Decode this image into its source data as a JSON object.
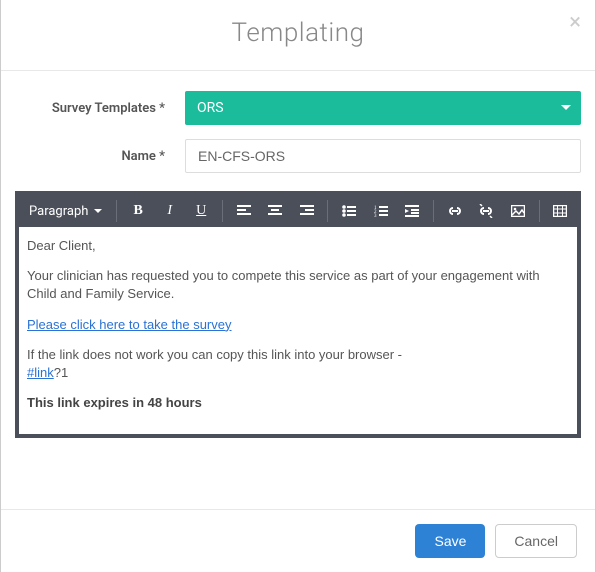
{
  "header": {
    "title": "Templating",
    "close": "×"
  },
  "form": {
    "survey_templates_label": "Survey Templates *",
    "survey_templates_value": "ORS",
    "name_label": "Name *",
    "name_value": "EN-CFS-ORS"
  },
  "editor": {
    "paragraph_label": "Paragraph",
    "content": {
      "greeting": "Dear Client,",
      "body": "Your clinician has requested you to compete this service as part of your engagement with Child and Family Service.",
      "link_text": "Please click here to take the survey",
      "fallback_prefix": "If the link does not work you can copy this link into your browser -",
      "raw_link": "#link",
      "raw_link_query": "?1",
      "expiry": "This link expires in 48 hours"
    }
  },
  "footer": {
    "save": "Save",
    "cancel": "Cancel"
  }
}
